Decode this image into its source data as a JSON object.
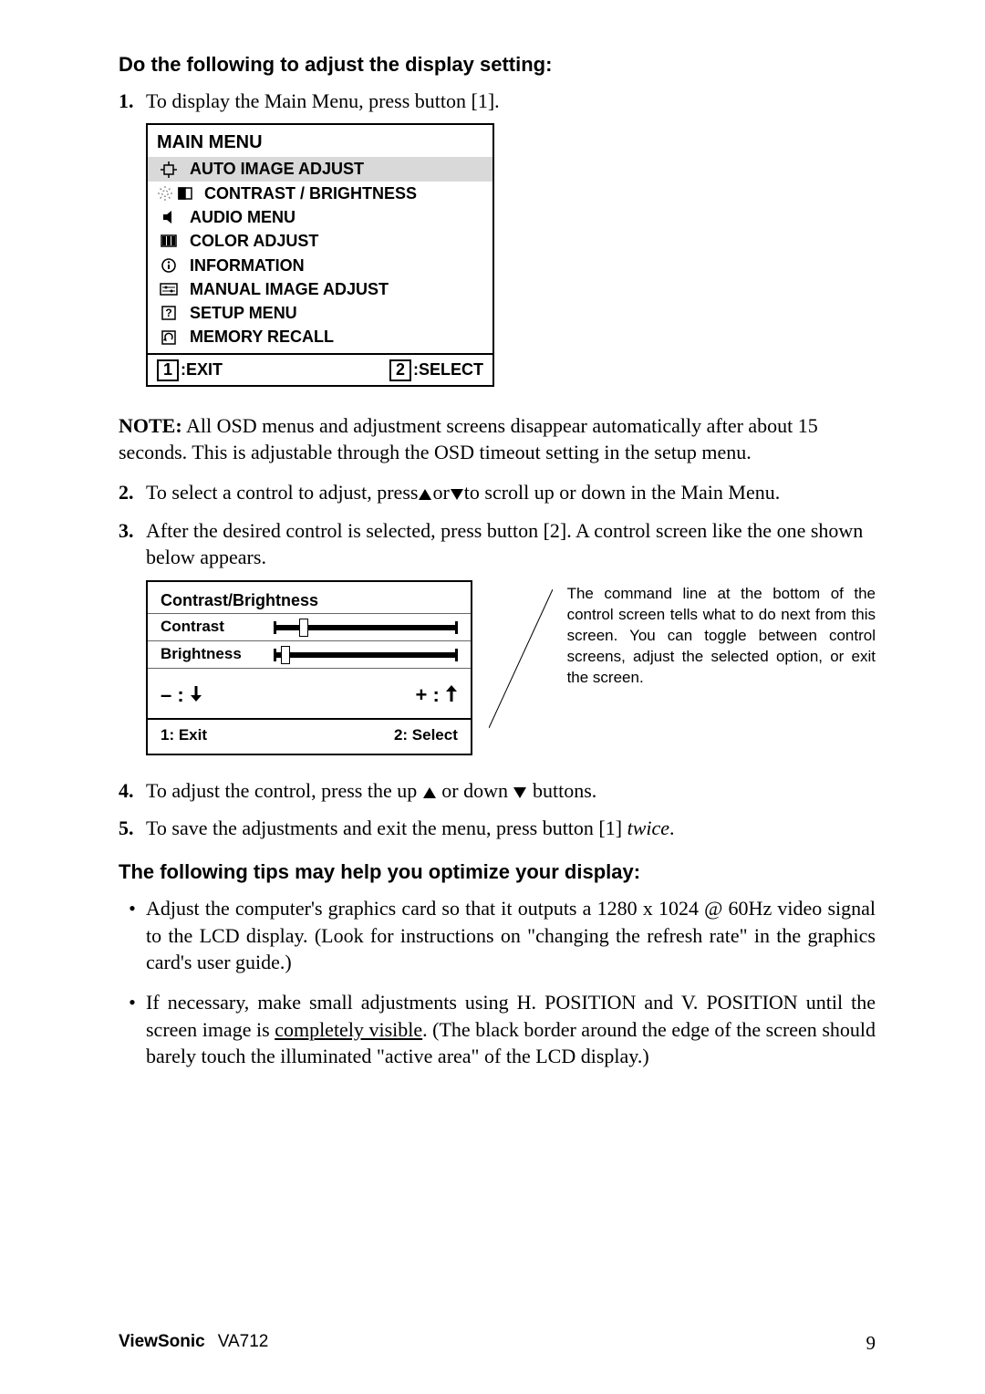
{
  "heading1": "Do the following to adjust the display setting:",
  "step1_num": "1.",
  "step1_text": "To display the Main Menu, press button [1].",
  "main_menu": {
    "title": "MAIN MENU",
    "items": [
      "AUTO IMAGE ADJUST",
      "CONTRAST / BRIGHTNESS",
      "AUDIO MENU",
      "COLOR ADJUST",
      "INFORMATION",
      "MANUAL IMAGE ADJUST",
      "SETUP MENU",
      "MEMORY RECALL"
    ],
    "footer_left_key": "1",
    "footer_left_label": ":EXIT",
    "footer_right_key": "2",
    "footer_right_label": ":SELECT"
  },
  "note_label": "NOTE:",
  "note_text": " All OSD menus and adjustment screens disappear automatically after about 15 seconds. This is adjustable through the OSD timeout setting in the setup menu.",
  "step2_num": "2.",
  "step2_pre": "To select a control to adjust, press",
  "step2_mid": "or",
  "step2_post": "to scroll up or down in the Main Menu.",
  "step3_num": "3.",
  "step3_text": "After the desired control is selected, press button [2]. A control screen like the one shown below appears.",
  "control": {
    "title": "Contrast/Brightness",
    "row1": "Contrast",
    "row2": "Brightness",
    "minus": "– : ",
    "plus": "+ : ",
    "footer_left": "1: Exit",
    "footer_right": "2: Select"
  },
  "caption": "The command line at the bottom of the control screen tells what to do next from this screen. You can toggle between control screens, adjust the selected option, or exit the screen.",
  "step4_num": "4.",
  "step4_pre": "To adjust the control, press the up ",
  "step4_mid": " or down ",
  "step4_post": " buttons.",
  "step5_num": "5.",
  "step5_pre": "To save the adjustments and exit the menu, press button [1] ",
  "step5_italic": "twice",
  "step5_post": ".",
  "heading2": "The following tips may help you optimize your display:",
  "tip1": "Adjust the computer's graphics card so that it outputs a 1280 x 1024 @ 60Hz video signal to the LCD display. (Look for instructions on \"changing the refresh rate\" in the graphics card's user guide.)",
  "tip2_pre": "If necessary, make small adjustments using H. POSITION and V. POSITION until the screen image is ",
  "tip2_underline": "completely visible",
  "tip2_post": ". (The black border around the edge of the screen should barely touch the illuminated \"active area\" of the LCD display.)",
  "footer_brand": "ViewSonic",
  "footer_model": "VA712",
  "footer_page": "9"
}
